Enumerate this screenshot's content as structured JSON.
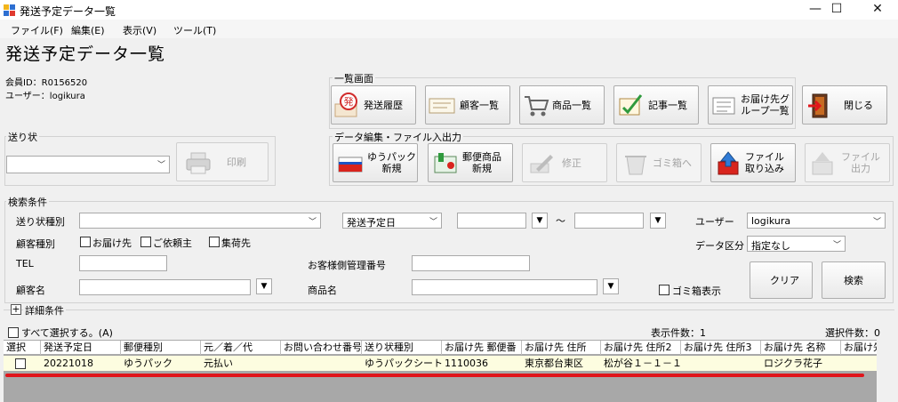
{
  "window": {
    "title": "発送予定データ一覧",
    "controls": {
      "minimize": "—",
      "maximize": "☐",
      "close": "✕"
    }
  },
  "menu": [
    "ファイル(F)",
    "編集(E)",
    "表示(V)",
    "ツール(T)"
  ],
  "page_title": "発送予定データ一覧",
  "member": {
    "id_text": "会員ID：R0156520",
    "user_text": "ユーザー：logikura"
  },
  "invoice_group": {
    "label": "送り状",
    "select_value": "",
    "print_label": "印刷"
  },
  "list_group": {
    "label": "一覧画面",
    "buttons": [
      {
        "label": "発送履歴",
        "icon": "shipping-history-icon"
      },
      {
        "label": "顧客一覧",
        "icon": "customer-list-icon"
      },
      {
        "label": "商品一覧",
        "icon": "cart-icon"
      },
      {
        "label": "記事一覧",
        "icon": "article-list-icon"
      },
      {
        "label": "お届け先グ\nループ一覧",
        "icon": "delivery-group-icon"
      }
    ],
    "close_label": "閉じる"
  },
  "edit_group": {
    "label": "データ編集・ファイル入出力",
    "buttons": [
      {
        "label": "ゆうパック\n新規",
        "icon": "yupack-icon",
        "enabled": true
      },
      {
        "label": "郵便商品\n新規",
        "icon": "postal-product-icon",
        "enabled": true
      },
      {
        "label": "修正",
        "icon": "edit-icon",
        "enabled": false
      },
      {
        "label": "ゴミ箱へ",
        "icon": "trash-icon",
        "enabled": false
      },
      {
        "label": "ファイル\n取り込み",
        "icon": "file-import-icon",
        "enabled": true
      },
      {
        "label": "ファイル\n出力",
        "icon": "file-export-icon",
        "enabled": false
      }
    ]
  },
  "search": {
    "label": "検索条件",
    "invoice_type_label": "送り状種別",
    "invoice_type_value": "",
    "date_type_value": "発送予定日",
    "date_from": "",
    "date_to": "",
    "tilde": "～",
    "user_label": "ユーザー",
    "user_value": "logikura",
    "customer_type_label": "顧客種別",
    "customer_options": [
      "お届け先",
      "ご依頼主",
      "集荷先"
    ],
    "data_kind_label": "データ区分",
    "data_kind_value": "指定なし",
    "tel_label": "TEL",
    "tel_value": "",
    "cust_mgmt_label": "お客様側管理番号",
    "cust_mgmt_value": "",
    "customer_name_label": "顧客名",
    "customer_name_value": "",
    "product_name_label": "商品名",
    "product_name_value": "",
    "trash_label": "ゴミ箱表示",
    "clear_label": "クリア",
    "search_label": "検索"
  },
  "details_label": "詳細条件",
  "select_all_label": "すべて選択する。(A)",
  "display_count": "表示件数：1",
  "selected_count": "選択件数：0",
  "table": {
    "columns": [
      "選択",
      "発送予定日",
      "郵便種別",
      "元／着／代",
      "お問い合わせ番号",
      "送り状種別",
      "お届け先 郵便番",
      "お届け先 住所",
      "お届け先 住所2",
      "お届け先 住所3",
      "お届け先 名称",
      "お届け先"
    ],
    "rows": [
      [
        "",
        "20221018",
        "ゆうパック",
        "元払い",
        "",
        "ゆうパックシート(A",
        "1110036",
        "東京都台東区",
        "松が谷１－１－１",
        "",
        "ロジクラ花子",
        ""
      ]
    ]
  },
  "colors": {
    "highlight_row": "#fdfde0",
    "annotation": "#e0151b"
  }
}
